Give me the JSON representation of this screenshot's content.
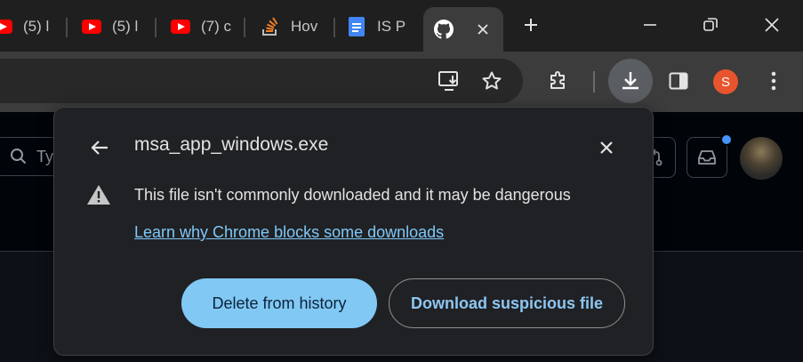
{
  "tabs": [
    {
      "title": "(5) l",
      "icon": "youtube-icon"
    },
    {
      "title": "(5) l",
      "icon": "youtube-icon"
    },
    {
      "title": "(7) c",
      "icon": "youtube-icon"
    },
    {
      "title": "Hov",
      "icon": "stackoverflow-icon"
    },
    {
      "title": "IS P",
      "icon": "docs-icon"
    },
    {
      "title": "",
      "icon": "github-icon",
      "active": true
    }
  ],
  "page": {
    "search_placeholder": "Ty"
  },
  "toolbar": {
    "profile_initial": "S"
  },
  "download_popup": {
    "filename": "msa_app_windows.exe",
    "warning": "This file isn't commonly downloaded and it may be dangerous",
    "learn_link": "Learn why Chrome blocks some downloads",
    "delete_label": "Delete from history",
    "download_label": "Download suspicious file"
  },
  "colors": {
    "accent": "#81c9f4",
    "link": "#7fc8f8",
    "profile": "#e8542d",
    "notification_dot": "#4493f8"
  }
}
